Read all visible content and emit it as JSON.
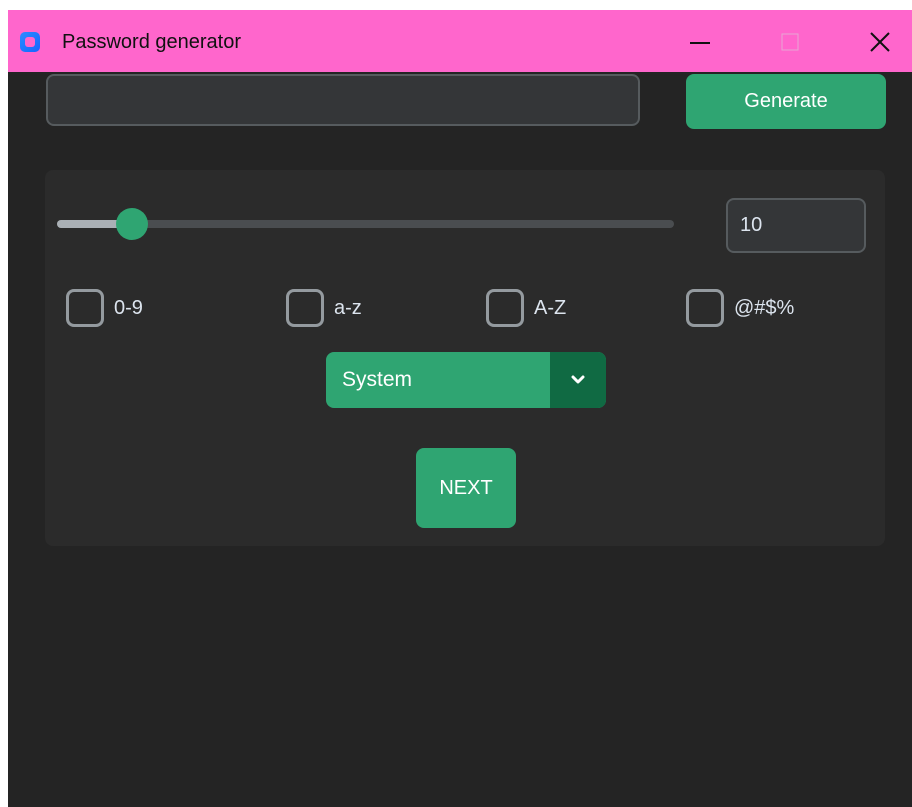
{
  "window": {
    "title": "Password generator",
    "colors": {
      "titlebar": "#ff66cc",
      "background": "#242424",
      "panel": "#2b2b2b",
      "accent": "#2fa572",
      "accent_dark": "#106a43"
    }
  },
  "password": {
    "value": ""
  },
  "generate_button": {
    "label": "Generate"
  },
  "length": {
    "value": "10",
    "min": 0,
    "max": 100
  },
  "options": [
    {
      "label": "0-9",
      "checked": false
    },
    {
      "label": "a-z",
      "checked": false
    },
    {
      "label": "A-Z",
      "checked": false
    },
    {
      "label": "@#$%",
      "checked": false
    }
  ],
  "theme_select": {
    "value": "System"
  },
  "next_button": {
    "label": "NEXT"
  }
}
